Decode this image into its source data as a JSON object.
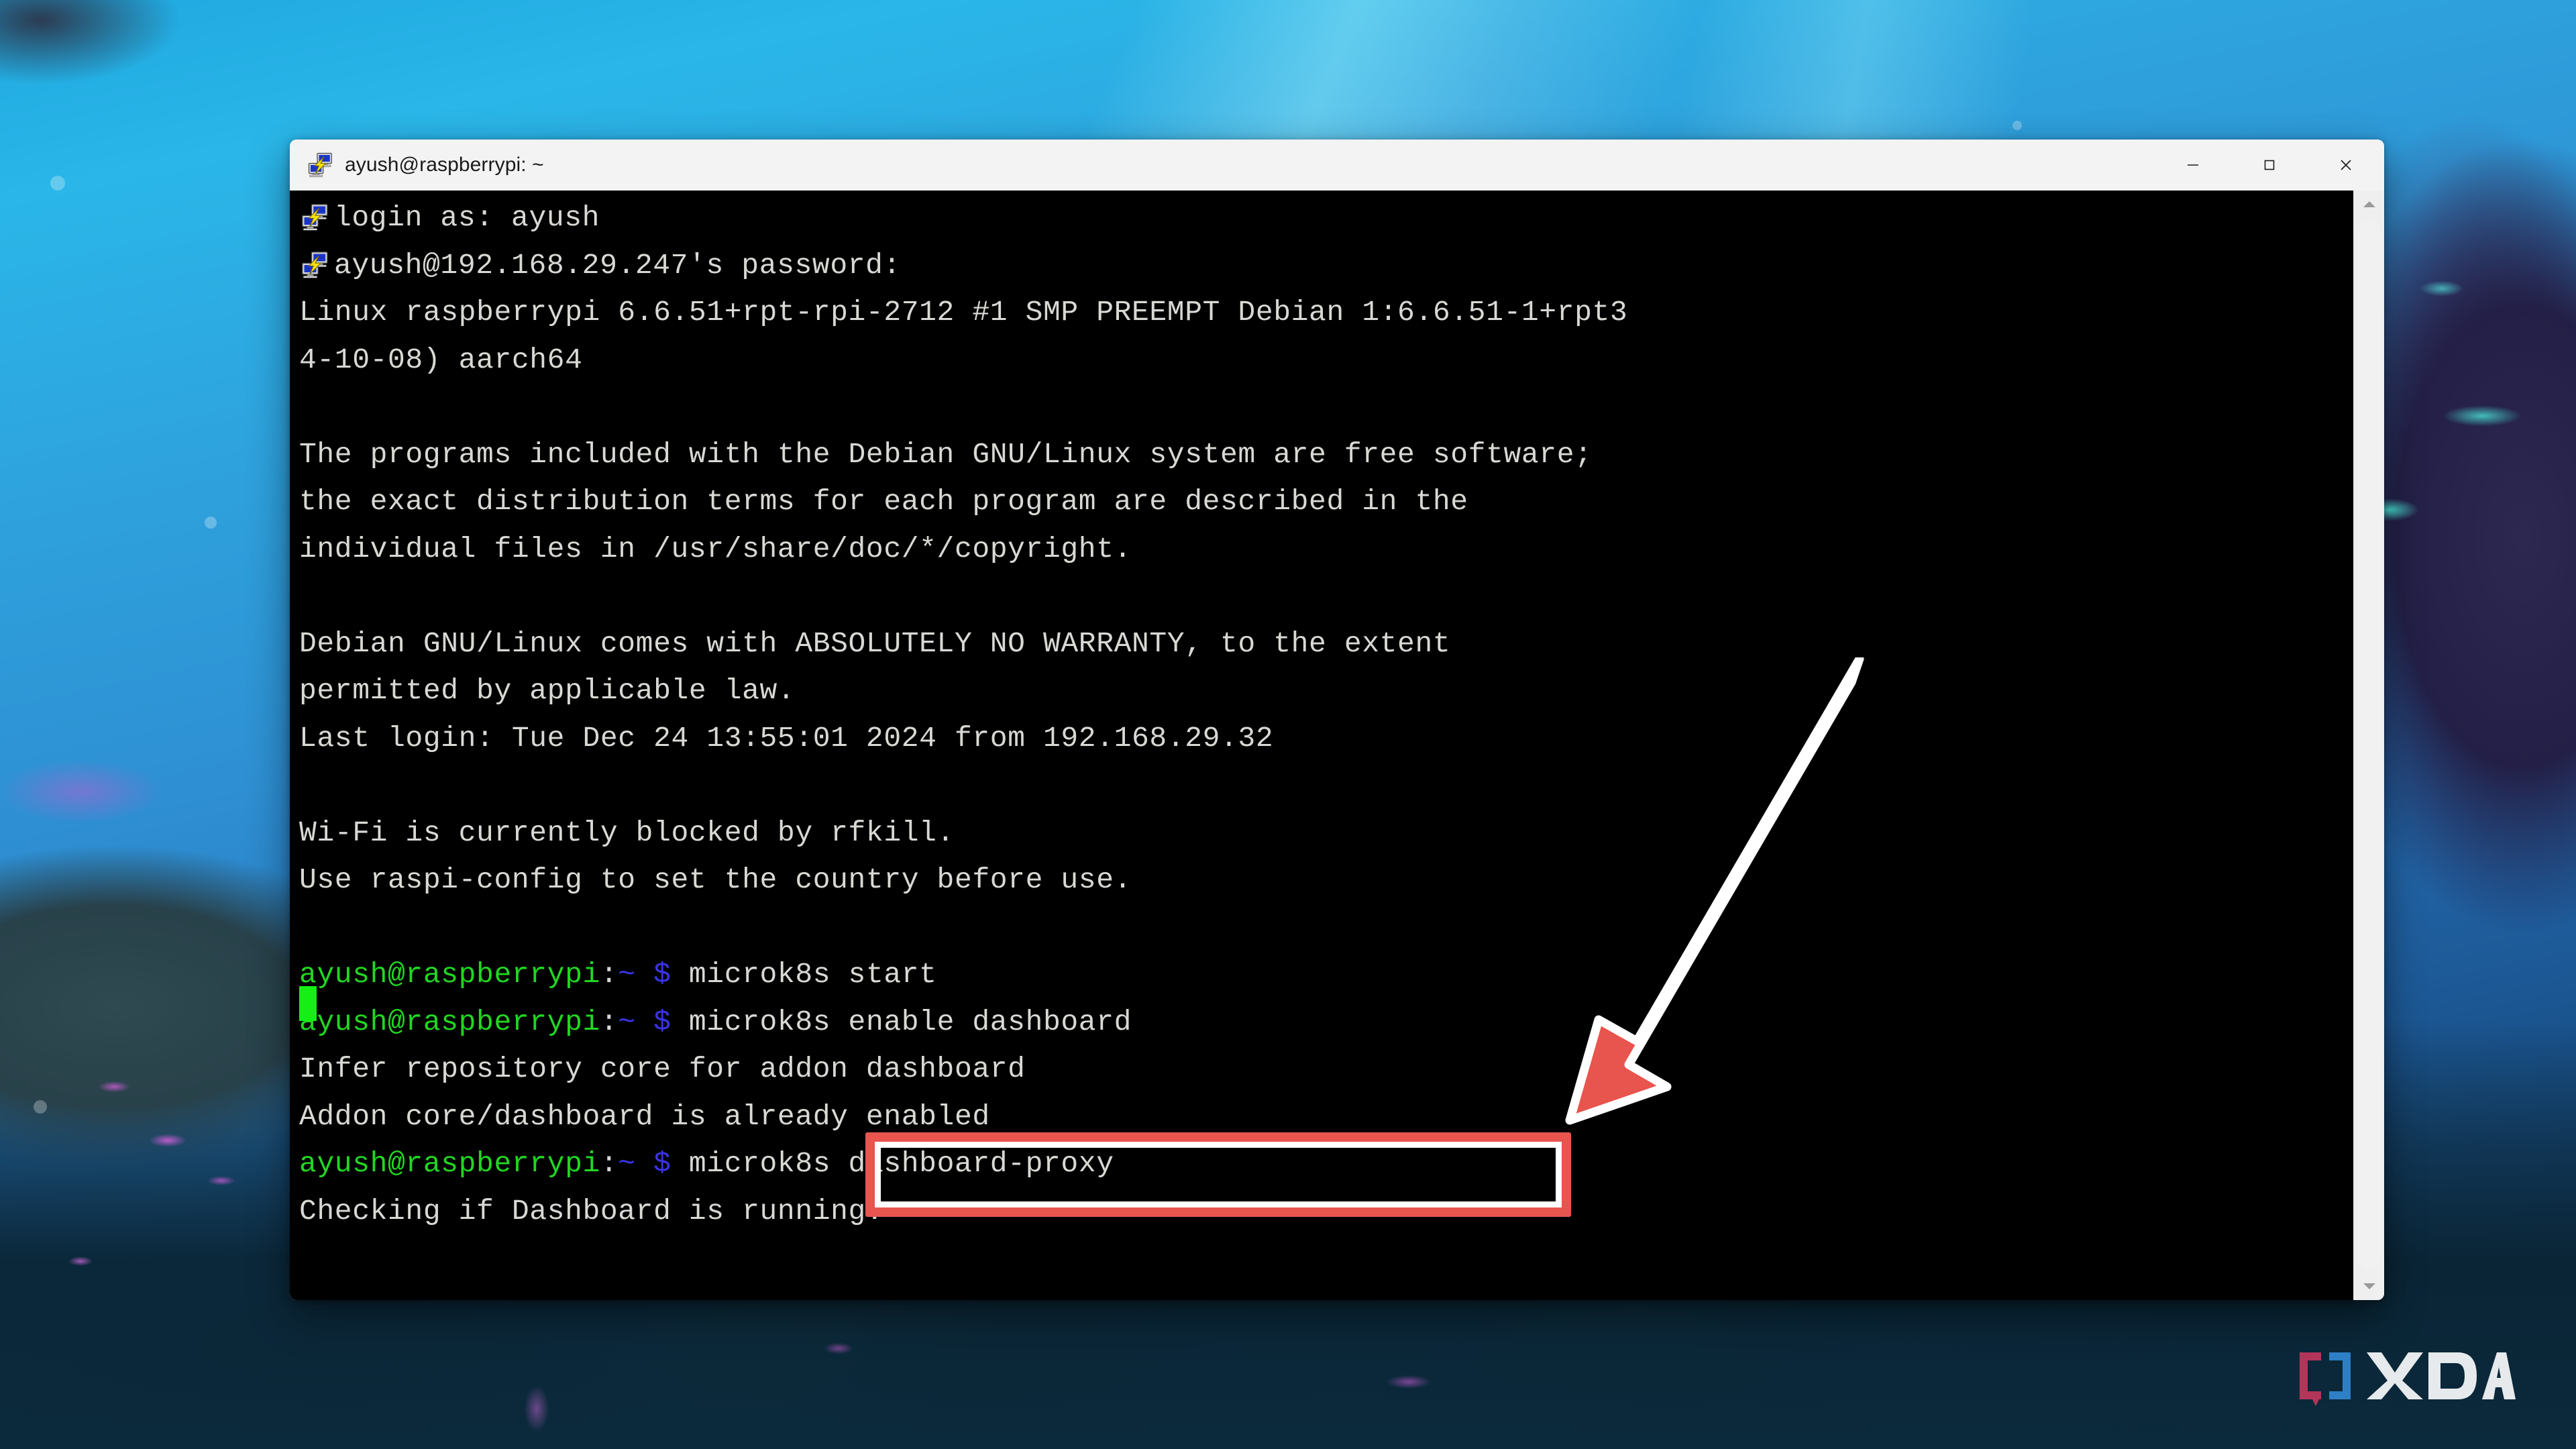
{
  "window": {
    "title": "ayush@raspberrypi: ~",
    "icon": "putty-icon",
    "controls": {
      "minimize_label": "Minimize",
      "maximize_label": "Maximize",
      "close_label": "Close"
    }
  },
  "terminal": {
    "lines": [
      {
        "id": "l01",
        "segments": [
          {
            "text": "login as: ayush",
            "color": "white"
          }
        ],
        "icon": "putty-icon"
      },
      {
        "id": "l02",
        "segments": [
          {
            "text": "ayush@192.168.29.247's password:",
            "color": "white"
          }
        ],
        "icon": "putty-icon"
      },
      {
        "id": "l03",
        "segments": [
          {
            "text": "Linux raspberrypi 6.6.51+rpt-rpi-2712 #1 SMP PREEMPT Debian 1:6.6.51-1+rpt3",
            "color": "white"
          }
        ]
      },
      {
        "id": "l04",
        "segments": [
          {
            "text": "4-10-08) aarch64",
            "color": "white"
          }
        ]
      },
      {
        "id": "l05",
        "segments": [
          {
            "text": "",
            "color": "white"
          }
        ]
      },
      {
        "id": "l06",
        "segments": [
          {
            "text": "The programs included with the Debian GNU/Linux system are free software;",
            "color": "white"
          }
        ]
      },
      {
        "id": "l07",
        "segments": [
          {
            "text": "the exact distribution terms for each program are described in the",
            "color": "white"
          }
        ]
      },
      {
        "id": "l08",
        "segments": [
          {
            "text": "individual files in /usr/share/doc/*/copyright.",
            "color": "white"
          }
        ]
      },
      {
        "id": "l09",
        "segments": [
          {
            "text": "",
            "color": "white"
          }
        ]
      },
      {
        "id": "l10",
        "segments": [
          {
            "text": "Debian GNU/Linux comes with ABSOLUTELY NO WARRANTY, to the extent",
            "color": "white"
          }
        ]
      },
      {
        "id": "l11",
        "segments": [
          {
            "text": "permitted by applicable law.",
            "color": "white"
          }
        ]
      },
      {
        "id": "l12",
        "segments": [
          {
            "text": "Last login: Tue Dec 24 13:55:01 2024 from 192.168.29.32",
            "color": "white"
          }
        ]
      },
      {
        "id": "l13",
        "segments": [
          {
            "text": "",
            "color": "white"
          }
        ]
      },
      {
        "id": "l14",
        "segments": [
          {
            "text": "Wi-Fi is currently blocked by rfkill.",
            "color": "white"
          }
        ]
      },
      {
        "id": "l15",
        "segments": [
          {
            "text": "Use raspi-config to set the country before use.",
            "color": "white"
          }
        ]
      },
      {
        "id": "l16",
        "segments": [
          {
            "text": "",
            "color": "white"
          }
        ]
      },
      {
        "id": "l17",
        "segments": [
          {
            "text": "ayush@raspberrypi",
            "color": "green"
          },
          {
            "text": ":",
            "color": "white"
          },
          {
            "text": "~",
            "color": "blue"
          },
          {
            "text": " ",
            "color": "white"
          },
          {
            "text": "$",
            "color": "blue"
          },
          {
            "text": " microk8s start",
            "color": "white"
          }
        ]
      },
      {
        "id": "l18",
        "segments": [
          {
            "text": "ayush@raspberrypi",
            "color": "green"
          },
          {
            "text": ":",
            "color": "white"
          },
          {
            "text": "~",
            "color": "blue"
          },
          {
            "text": " ",
            "color": "white"
          },
          {
            "text": "$",
            "color": "blue"
          },
          {
            "text": " microk8s enable dashboard",
            "color": "white"
          }
        ]
      },
      {
        "id": "l19",
        "segments": [
          {
            "text": "Infer repository core for addon dashboard",
            "color": "white"
          }
        ]
      },
      {
        "id": "l20",
        "segments": [
          {
            "text": "Addon core/dashboard is already enabled",
            "color": "white"
          }
        ]
      },
      {
        "id": "l21",
        "segments": [
          {
            "text": "ayush@raspberrypi",
            "color": "green"
          },
          {
            "text": ":",
            "color": "white"
          },
          {
            "text": "~",
            "color": "blue"
          },
          {
            "text": " ",
            "color": "white"
          },
          {
            "text": "$",
            "color": "blue"
          },
          {
            "text": " microk8s dashboard-proxy",
            "color": "white"
          }
        ]
      },
      {
        "id": "l22",
        "segments": [
          {
            "text": "Checking if Dashboard is running.",
            "color": "white"
          }
        ]
      }
    ],
    "cursor": "block-cursor",
    "colors": {
      "background": "#000000",
      "foreground": "#d8d8d4",
      "green": "#22d622",
      "blue": "#3a35e6",
      "cursor": "#16ef16"
    }
  },
  "scrollbar": {
    "up_arrow": "scroll-up-arrow",
    "down_arrow": "scroll-down-arrow",
    "thumb": "scroll-thumb"
  },
  "annotations": {
    "highlight": {
      "name": "command-highlight-box",
      "target_text": "microk8s dashboard-proxy",
      "color": "#e8544e"
    },
    "arrow": {
      "name": "pointer-arrow",
      "color": "#e8544e",
      "direction": "down-left"
    }
  },
  "watermark": {
    "name": "xda-logo",
    "text": "XDA",
    "bracket_left_color": "#b4355a",
    "bracket_right_color": "#2f7fc4",
    "text_color": "#e6eaec"
  }
}
